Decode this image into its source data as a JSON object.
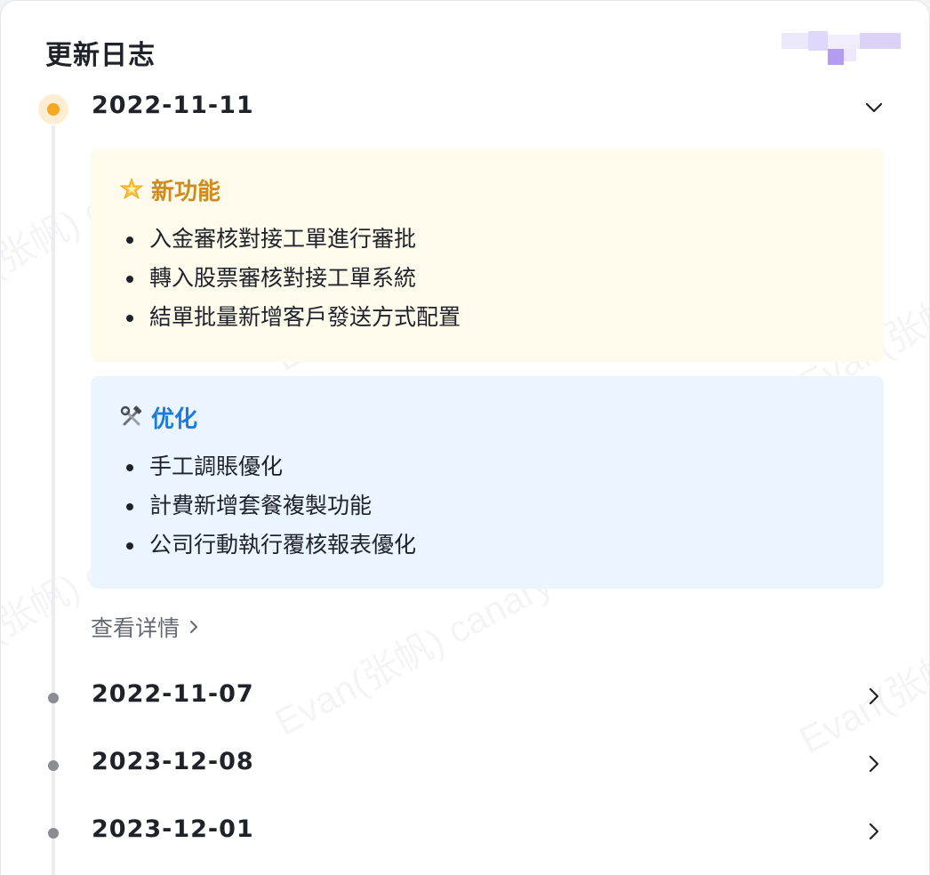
{
  "header": {
    "title": "更新日志"
  },
  "timeline": {
    "expanded": {
      "date": "2022-11-11",
      "state_icon": "chevron-down-icon",
      "sections": [
        {
          "icon": "sparkle-star-icon",
          "title": "新功能",
          "items": [
            "入金審核對接工單進行審批",
            "轉入股票審核對接工單系統",
            "結單批量新增客戶發送方式配置"
          ],
          "background": "#fefaec",
          "title_color": "#d08b1d"
        },
        {
          "icon": "hammer-wrench-icon",
          "title": "优化",
          "items": [
            "手工調賬優化",
            "計費新增套餐複製功能",
            "公司行動執行覆核報表優化"
          ],
          "background": "#eaf5ff",
          "title_color": "#1a7ae0"
        }
      ],
      "detail_link": "查看详情"
    },
    "collapsed": [
      {
        "date": "2022-11-07"
      },
      {
        "date": "2023-12-08"
      },
      {
        "date": "2023-12-01"
      }
    ]
  },
  "watermark": {
    "text": "Evan(张帆) canary"
  },
  "colors": {
    "active_dot": "#f5a623",
    "inactive_dot": "#8a8d93",
    "link": "#646a73"
  }
}
